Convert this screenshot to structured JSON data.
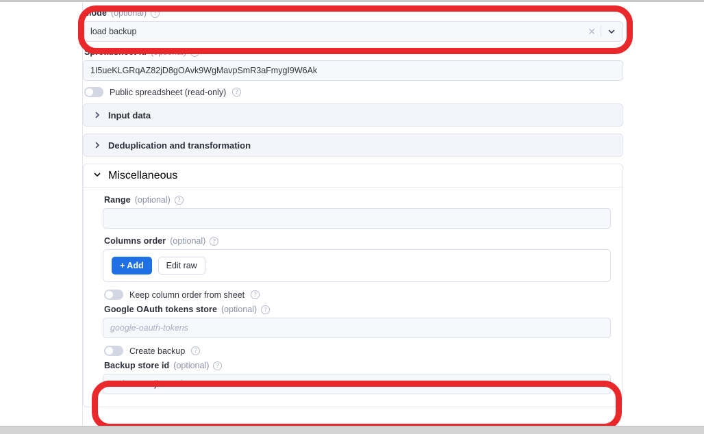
{
  "fields": {
    "mode": {
      "label": "Mode",
      "optional": "(optional)",
      "value": "load backup",
      "clear_icon": "close-icon",
      "dropdown_icon": "chevron-down-icon"
    },
    "spreadsheet_id": {
      "label": "Spreadsheet id",
      "optional": "(optional)",
      "value": "1I5ueKLGRqAZ82jD8gOAvk9WgMavpSmR3aFmygI9W6Ak"
    },
    "public_spreadsheet": {
      "label": "Public spreadsheet (read-only)",
      "state": "off"
    },
    "range": {
      "label": "Range",
      "optional": "(optional)",
      "value": ""
    },
    "columns_order": {
      "label": "Columns order",
      "optional": "(optional)",
      "add_label": "+ Add",
      "edit_raw_label": "Edit raw"
    },
    "keep_column_order": {
      "label": "Keep column order from sheet",
      "state": "off"
    },
    "google_oauth_tokens_store": {
      "label": "Google OAuth tokens store",
      "optional": "(optional)",
      "value": "",
      "placeholder": "google-oauth-tokens"
    },
    "create_backup": {
      "label": "Create backup",
      "state": "off"
    },
    "backup_store_id": {
      "label": "Backup store id",
      "optional": "(optional)",
      "value": "ru0laIVCD9jkKWRla"
    }
  },
  "sections": [
    {
      "title": "Input data",
      "expanded": false,
      "icon": "chevron-right-icon"
    },
    {
      "title": "Deduplication and transformation",
      "expanded": false,
      "icon": "chevron-right-icon"
    },
    {
      "title": "Miscellaneous",
      "expanded": true,
      "icon": "chevron-down-icon"
    }
  ],
  "help_icon_glyph": "?",
  "colors": {
    "annotation": "#e8282b",
    "primary_button": "#1f6fe5",
    "input_background": "#f7f8fc",
    "section_background": "#f4f5fb",
    "optional_text": "#8a90a8"
  },
  "annotations": [
    {
      "name": "mode-highlight",
      "target": "Mode"
    },
    {
      "name": "backup-store-id-highlight",
      "target": "Backup store id"
    }
  ]
}
